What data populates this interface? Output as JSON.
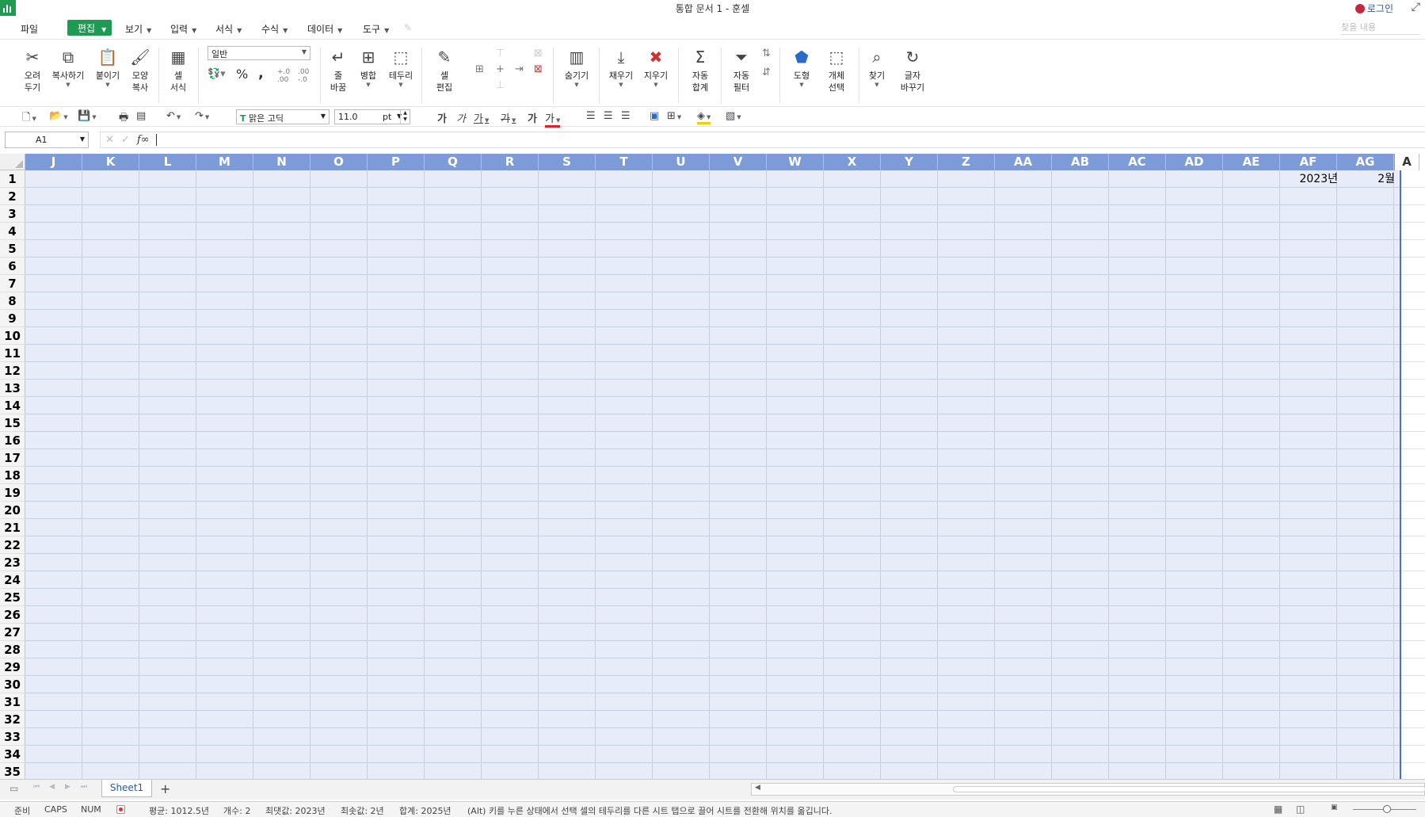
{
  "app": {
    "title": "통합 문서 1 - 훈셀",
    "login": "로그인"
  },
  "menu": {
    "file": "파일",
    "edit": "편집",
    "view": "보기",
    "insert": "입력",
    "format": "서식",
    "formula": "수식",
    "data": "데이터",
    "tools": "도구",
    "search_placeholder": "찾을 내용"
  },
  "ribbon": {
    "cut": [
      "오려",
      "두기"
    ],
    "copy": "복사하기",
    "paste": "붙이기",
    "format_painter": [
      "모양",
      "복사"
    ],
    "cell_format": [
      "셀",
      "서식"
    ],
    "number_format": "일반",
    "percent": "%",
    "comma": ",",
    "wrap": [
      "줄",
      "바꿈"
    ],
    "merge": "병합",
    "border": "테두리",
    "cell_edit": [
      "셀",
      "편집"
    ],
    "hide": "숨기기",
    "fill": "채우기",
    "clear": "지우기",
    "autosum": [
      "자동",
      "합계"
    ],
    "autofilter": [
      "자동",
      "필터"
    ],
    "shape": "도형",
    "select_object": [
      "개체",
      "선택"
    ],
    "find": "찾기",
    "replace": [
      "글자",
      "바꾸기"
    ]
  },
  "toolbar2": {
    "font": "맑은 고딕",
    "size": "11.0",
    "unit": "pt",
    "bold": "가",
    "italic": "가",
    "underline": "가",
    "strike": "가",
    "shadow": "가",
    "fontcolor": "가"
  },
  "formula": {
    "cell_ref": "A1",
    "value": ""
  },
  "grid": {
    "columns": [
      "J",
      "K",
      "L",
      "M",
      "N",
      "O",
      "P",
      "Q",
      "R",
      "S",
      "T",
      "U",
      "V",
      "W",
      "X",
      "Y",
      "Z",
      "AA",
      "AB",
      "AC",
      "AD",
      "AE",
      "AF",
      "AG",
      "A"
    ],
    "rows": [
      "1",
      "2",
      "3",
      "4",
      "5",
      "6",
      "7",
      "8",
      "9",
      "10",
      "11",
      "12",
      "13",
      "14",
      "15",
      "16",
      "17",
      "18",
      "19",
      "20",
      "21",
      "22",
      "23",
      "24",
      "25",
      "26",
      "27",
      "28",
      "29",
      "30",
      "31",
      "32",
      "33",
      "34",
      "35"
    ],
    "cells": {
      "AF1": "2023년",
      "AG1": "2월"
    }
  },
  "sheets": {
    "active": "Sheet1"
  },
  "status": {
    "ready": "준비",
    "caps": "CAPS",
    "num": "NUM",
    "average": "평균: 1012.5년",
    "count": "개수: 2",
    "max": "최댓값: 2023년",
    "min": "최솟값: 2년",
    "sum": "합계: 2025년",
    "hint": "(Alt) 키를 누른 상태에서 선택 셀의 테두리를 다른 시트 탭으로 끌어 시트를 전환해 위치를 옮깁니다."
  }
}
